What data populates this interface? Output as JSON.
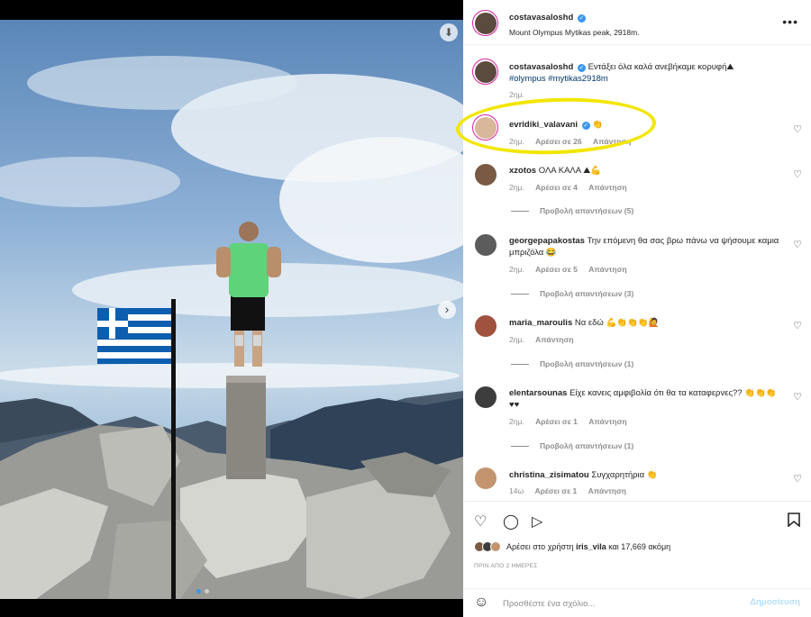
{
  "post": {
    "author": "costavasaloshd",
    "location": "Mount Olympus Mytikas peak, 2918m.",
    "caption_text": "Εντάξει όλα καλά ανεβήκαμε κορυφή⛰",
    "caption_tags": "#olympus #mytikas2918m",
    "caption_time": "2ημ."
  },
  "comments": [
    {
      "user": "evridiki_valavani",
      "verified": true,
      "text": "👏",
      "time": "2ημ.",
      "likes": "Αρέσει σε 26",
      "reply": "Απάντηση"
    },
    {
      "user": "xzotos",
      "verified": false,
      "text": "ΟΛΑ ΚΑΛΑ ⛰💪",
      "time": "2ημ.",
      "likes": "Αρέσει σε 4",
      "reply": "Απάντηση",
      "view_replies": "Προβολή απαντήσεων (5)"
    },
    {
      "user": "georgepapakostas",
      "verified": false,
      "text": "Την επόμενη θα σας βρω πάνω να ψήσουμε καμια μπριζόλα 😂",
      "time": "2ημ.",
      "likes": "Αρέσει σε 5",
      "reply": "Απάντηση",
      "view_replies": "Προβολή απαντήσεων (3)"
    },
    {
      "user": "maria_maroulis",
      "verified": false,
      "text": "Να εδώ 💪👏👏👏🙋",
      "time": "2ημ.",
      "likes": "",
      "reply": "Απάντηση",
      "view_replies": "Προβολή απαντήσεων (1)"
    },
    {
      "user": "elentarsounas",
      "verified": false,
      "text": "Είχε κανεις αμφιβολία ότι θα τα καταφερνες?? 👏👏👏♥♥",
      "time": "2ημ.",
      "likes": "Αρέσει σε 1",
      "reply": "Απάντηση",
      "view_replies": "Προβολή απαντήσεων (1)"
    },
    {
      "user": "christina_zisimatou",
      "verified": false,
      "text": "Συγχαρητήρια 👏",
      "time": "14ω",
      "likes": "Αρέσει σε 1",
      "reply": "Απάντηση"
    }
  ],
  "likes_line": {
    "prefix": "Αρέσει στο χρήστη",
    "user": "iris_vila",
    "suffix": "και 17,669 ακόμη"
  },
  "post_time": "ΠΡΙΝ ΑΠΟ 2 ΗΜΕΡΕΣ",
  "add_comment": {
    "placeholder": "Προσθέστε ένα σχόλιο...",
    "post_label": "Δημοσίευση"
  },
  "icons": {
    "verified": "✓",
    "more": "•••",
    "heart": "♡",
    "comment": "◯",
    "share": "▷",
    "save": "🔖",
    "smile": "☺",
    "download": "⬇",
    "next": "›"
  },
  "colors": {
    "accent": "#3897f0",
    "highlight": "#f2e600",
    "muted": "#8e8e8e",
    "ring": "#d6249f"
  }
}
